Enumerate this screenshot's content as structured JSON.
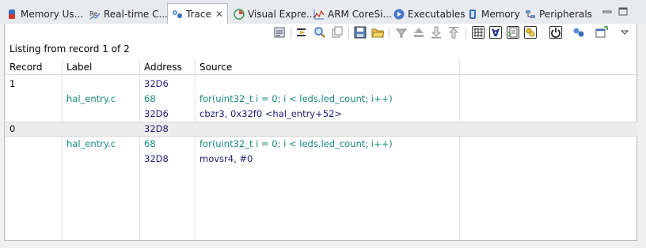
{
  "tabs": [
    {
      "label": "Memory Us...",
      "icon": "memory-usage-icon",
      "active": false
    },
    {
      "label": "Real-time C...",
      "icon": "realtime-chart-icon",
      "active": false
    },
    {
      "label": "Trace",
      "icon": "trace-icon",
      "active": true
    },
    {
      "label": "Visual Expre...",
      "icon": "visual-expressions-icon",
      "active": false
    },
    {
      "label": "ARM CoreSi...",
      "icon": "arm-coresight-icon",
      "active": false
    },
    {
      "label": "Executables",
      "icon": "executables-icon",
      "active": false
    },
    {
      "label": "Memory",
      "icon": "memory-icon",
      "active": false
    },
    {
      "label": "Peripherals",
      "icon": "peripherals-icon",
      "active": false
    }
  ],
  "listing_text": "Listing from record 1 of 2",
  "columns": [
    "Record",
    "Label",
    "Address",
    "Source"
  ],
  "rows": [
    {
      "record": "1",
      "label": "",
      "address": "32D6",
      "source": "",
      "selected": false
    },
    {
      "record": "",
      "label": "hal_entry.c",
      "address": "68",
      "source": "for(uint32_t i = 0; i < leds.led_count; i++)",
      "selected": false
    },
    {
      "record": "",
      "label": "",
      "address": "32D6",
      "source": "cbzr3, 0x32f0 <hal_entry+52>",
      "selected": false
    },
    {
      "record": "0",
      "label": "",
      "address": "32D8",
      "source": "",
      "selected": true
    },
    {
      "record": "",
      "label": "hal_entry.c",
      "address": "68",
      "source": "for(uint32_t i = 0; i < leds.led_count; i++)",
      "selected": false
    },
    {
      "record": "",
      "label": "",
      "address": "32D8",
      "source": "movsr4, #0",
      "selected": false
    }
  ],
  "colors": {
    "teal": "#17897f",
    "navy": "#1d1d78",
    "selected_row": "#ececec"
  }
}
